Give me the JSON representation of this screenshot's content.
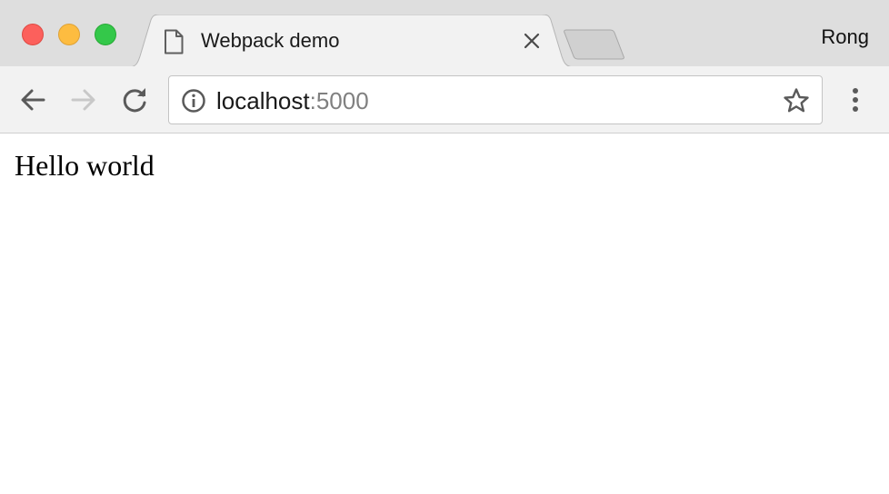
{
  "window": {
    "traffic_lights": {
      "close_color": "#fc605c",
      "minimize_color": "#fdbc40",
      "maximize_color": "#34c84a"
    }
  },
  "tab": {
    "title": "Webpack demo",
    "icon": "document-icon",
    "close_icon": "close-icon"
  },
  "new_tab": {
    "icon": "new-tab-icon"
  },
  "profile": {
    "name": "Rong"
  },
  "toolbar": {
    "back_icon": "arrow-left-icon",
    "forward_icon": "arrow-right-icon",
    "forward_enabled": false,
    "reload_icon": "reload-icon",
    "menu_icon": "more-vertical-icon"
  },
  "omnibox": {
    "security_icon": "info-icon",
    "url_host": "localhost",
    "url_port": ":5000",
    "bookmark_icon": "star-icon"
  },
  "page": {
    "text": "Hello world"
  },
  "colors": {
    "tabstrip_bg": "#dedede",
    "toolbar_bg": "#f2f2f2",
    "active_tab_bg": "#f2f2f2",
    "port_text": "#808080"
  }
}
